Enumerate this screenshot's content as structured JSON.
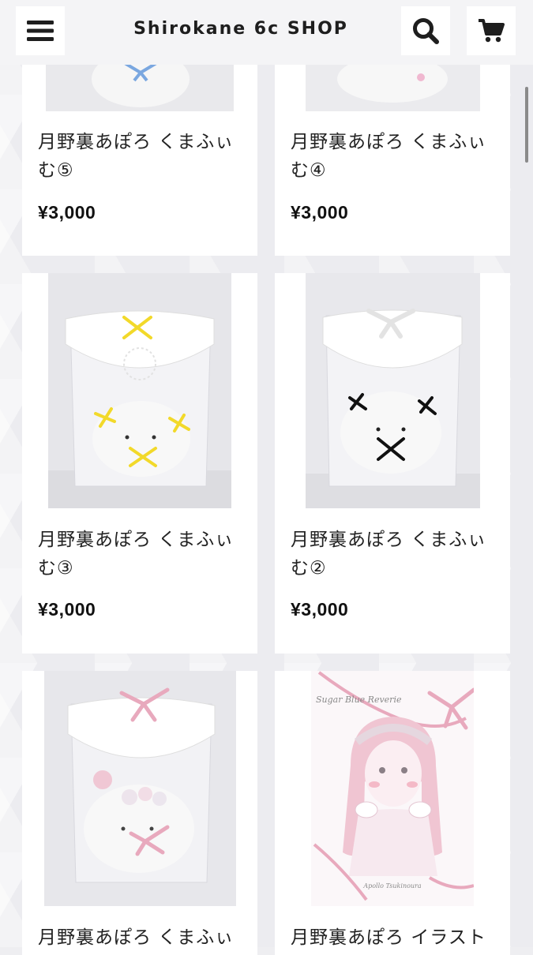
{
  "header": {
    "title": "Shirokane 6c SHOP",
    "menu_icon": "hamburger-menu-icon",
    "search_icon": "search-icon",
    "cart_icon": "cart-icon"
  },
  "products": [
    {
      "name_line1": "月野裏あぽろ くまふぃ",
      "name_line2": "む⑤",
      "price": "¥3,000",
      "ribbon_color": "#7aa7e0"
    },
    {
      "name_line1": "月野裏あぽろ くまふぃ",
      "name_line2": "む④",
      "price": "¥3,000",
      "ribbon_color": "#f0b8d0"
    },
    {
      "name_line1": "月野裏あぽろ くまふぃ",
      "name_line2": "む③",
      "price": "¥3,000",
      "ribbon_color": "#f2d92a"
    },
    {
      "name_line1": "月野裏あぽろ くまふぃ",
      "name_line2": "む②",
      "price": "¥3,000",
      "ribbon_color": "#111111"
    },
    {
      "name_line1": "月野裏あぽろ くまふぃ",
      "name_line2": "",
      "price": "",
      "ribbon_color": "#e8a9bd"
    },
    {
      "name_line1": "月野裏あぽろ イラスト",
      "name_line2": "",
      "price": "",
      "ribbon_color": "#e8a9bd"
    }
  ],
  "artbook": {
    "cover_title": "Sugar Blue Reverie",
    "cover_author": "Apollo Tsukinoura"
  }
}
